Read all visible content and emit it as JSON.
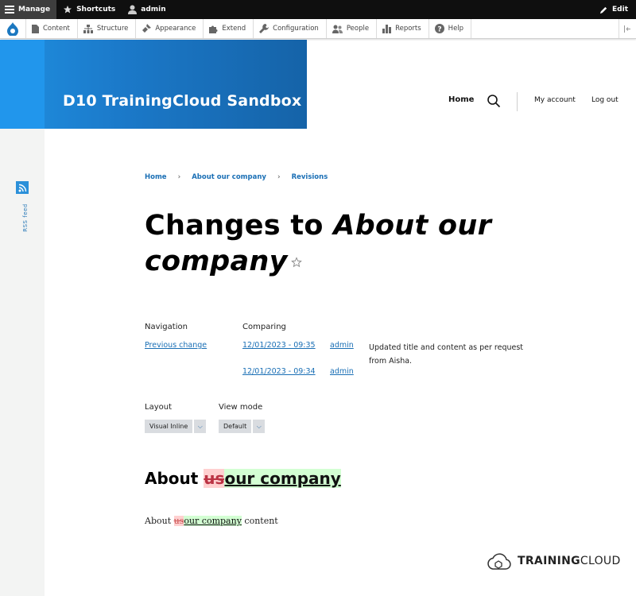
{
  "toolbar": {
    "manage": "Manage",
    "shortcuts": "Shortcuts",
    "user": "admin",
    "edit": "Edit"
  },
  "tray": {
    "items": [
      "Content",
      "Structure",
      "Appearance",
      "Extend",
      "Configuration",
      "People",
      "Reports",
      "Help"
    ]
  },
  "site": {
    "name": "D10 TrainingCloud Sandbox"
  },
  "nav": {
    "home": "Home",
    "my_account": "My account",
    "log_out": "Log out"
  },
  "rss": {
    "label": "RSS feed"
  },
  "breadcrumb": [
    "Home",
    "About our company",
    "Revisions"
  ],
  "title": {
    "prefix": "Changes to ",
    "node": "About our company"
  },
  "revisions": {
    "navigation_header": "Navigation",
    "comparing_header": "Comparing",
    "previous_change": "Previous change",
    "rev1_date": "12/01/2023 - 09:35",
    "rev1_author": "admin",
    "rev1_message": "Updated title and content as per request from Aisha.",
    "rev2_date": "12/01/2023 - 09:34",
    "rev2_author": "admin"
  },
  "options": {
    "layout_label": "Layout",
    "layout_value": "Visual Inline",
    "viewmode_label": "View mode",
    "viewmode_value": "Default"
  },
  "diff": {
    "heading_prefix": "About ",
    "heading_removed": "us",
    "heading_added": "our company",
    "body_prefix": "About ",
    "body_removed": "us",
    "body_added": "our company",
    "body_suffix": " content"
  },
  "footer": {
    "brand_bold": "TRAINING",
    "brand_rest": "CLOUD"
  },
  "colors": {
    "brand_blue": "#1b79c9",
    "link": "#1a6fb5",
    "removed": "#ffd0d0",
    "added": "#d3ffd3"
  }
}
